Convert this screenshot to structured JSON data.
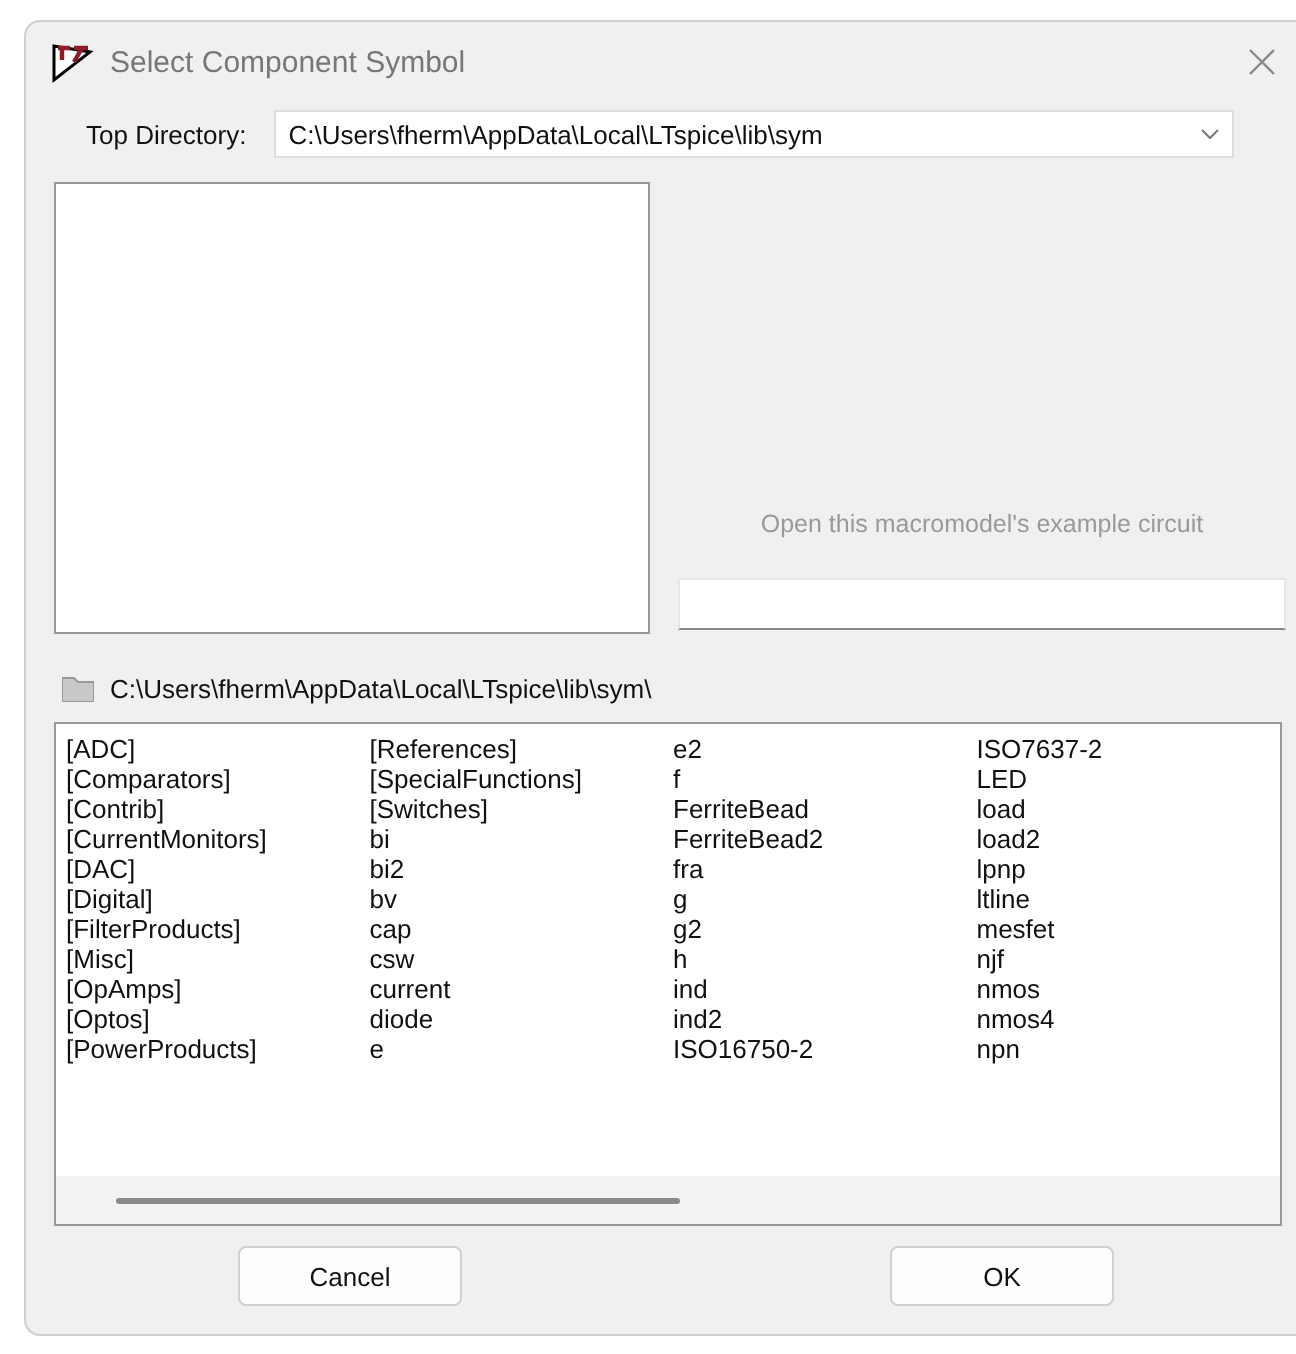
{
  "window": {
    "title": "Select Component Symbol"
  },
  "top_directory": {
    "label": "Top Directory:",
    "value": "C:\\Users\\fherm\\AppData\\Local\\LTspice\\lib\\sym"
  },
  "example_link": {
    "label": "Open this macromodel's example circuit",
    "disabled": true
  },
  "current_path": "C:\\Users\\fherm\\AppData\\Local\\LTspice\\lib\\sym\\",
  "items": [
    [
      "[ADC]",
      "[Comparators]",
      "[Contrib]",
      "[CurrentMonitors]",
      "[DAC]",
      "[Digital]",
      "[FilterProducts]",
      "[Misc]",
      "[OpAmps]",
      "[Optos]",
      "[PowerProducts]"
    ],
    [
      "[References]",
      "[SpecialFunctions]",
      "[Switches]",
      "bi",
      "bi2",
      "bv",
      "cap",
      "csw",
      "current",
      "diode",
      "e"
    ],
    [
      "e2",
      "f",
      "FerriteBead",
      "FerriteBead2",
      "fra",
      "g",
      "g2",
      "h",
      "ind",
      "ind2",
      "ISO16750-2"
    ],
    [
      "ISO7637-2",
      "LED",
      "load",
      "load2",
      "lpnp",
      "ltline",
      "mesfet",
      "njf",
      "nmos",
      "nmos4",
      "npn"
    ]
  ],
  "buttons": [
    "Cancel",
    "OK"
  ]
}
